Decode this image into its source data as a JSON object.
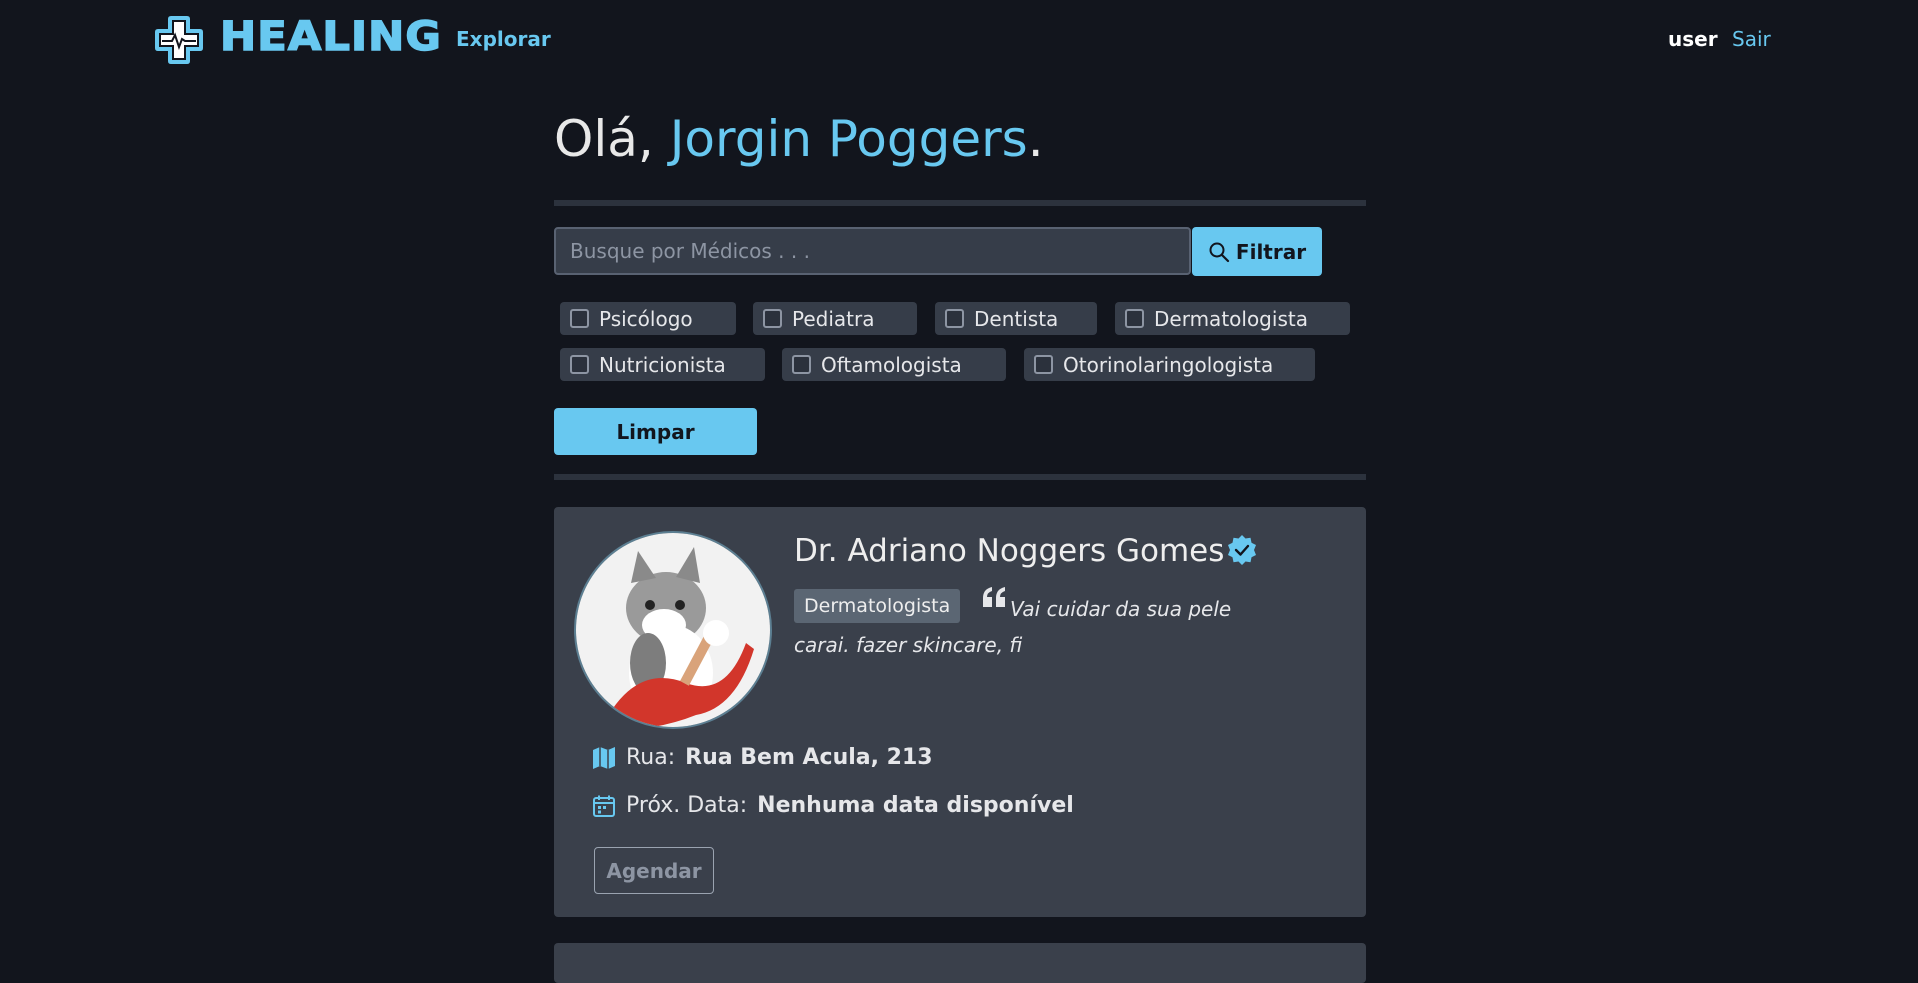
{
  "nav": {
    "brand": "HEALING",
    "explore_label": "Explorar",
    "user_label": "user",
    "logout_label": "Sair"
  },
  "greeting": {
    "prefix": "Olá, ",
    "name": "Jorgin Poggers",
    "suffix": "."
  },
  "search": {
    "placeholder": "Busque por Médicos . . .",
    "value": "",
    "filter_label": "Filtrar"
  },
  "specialty_filters": [
    {
      "label": "Psicólogo",
      "checked": false
    },
    {
      "label": "Pediatra",
      "checked": false
    },
    {
      "label": "Dentista",
      "checked": false
    },
    {
      "label": "Dermatologista",
      "checked": false
    },
    {
      "label": "Nutricionista",
      "checked": false
    },
    {
      "label": "Oftamologista",
      "checked": false
    },
    {
      "label": "Otorinolaringologista",
      "checked": false
    }
  ],
  "clear_label": "Limpar",
  "doctors": [
    {
      "name": "Dr. Adriano Noggers Gomes",
      "verified": true,
      "specialty": "Dermatologista",
      "quote": "Vai cuidar da sua pele carai. fazer skincare, fi",
      "address_label": "Rua:",
      "address_value": "Rua Bem Acula, 213",
      "next_date_label": "Próx. Data:",
      "next_date_value": "Nenhuma data disponível",
      "book_label": "Agendar"
    }
  ],
  "colors": {
    "accent": "#68c8f0",
    "background": "#12151d",
    "card": "#3a404b"
  }
}
